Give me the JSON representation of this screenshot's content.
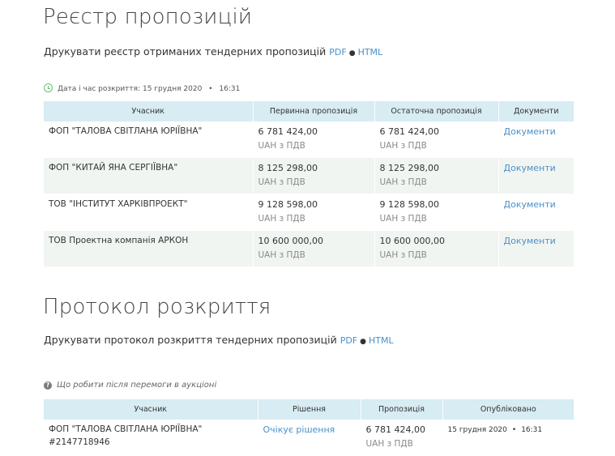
{
  "registry": {
    "title": "Реєстр пропозицій",
    "print_text": "Друкувати реєстр отриманих тендерних пропозицій",
    "pdf_label": "PDF",
    "html_label": "HTML",
    "separator": "●",
    "opening_label": "Дата і час розкриття: 15 грудня 2020",
    "opening_sep": "•",
    "opening_time": "16:31",
    "columns": [
      "Учасник",
      "Первинна пропозиція",
      "Остаточна пропозиція",
      "Документи"
    ],
    "rows": [
      {
        "participant": "ФОП \"ТАЛОВА СВІТЛАНА ЮРІЇВНА\"",
        "initial": "6 781 424,00",
        "initial_currency": "UAH з ПДВ",
        "final": "6 781 424,00",
        "final_currency": "UAH з ПДВ",
        "docs": "Документи"
      },
      {
        "participant": "ФОП \"КИТАЙ ЯНА СЕРГІЇВНА\"",
        "initial": "8 125 298,00",
        "initial_currency": "UAH з ПДВ",
        "final": "8 125 298,00",
        "final_currency": "UAH з ПДВ",
        "docs": "Документи"
      },
      {
        "participant": "ТОВ \"ІНСТИТУТ ХАРКІВПРОЕКТ\"",
        "initial": "9 128 598,00",
        "initial_currency": "UAH з ПДВ",
        "final": "9 128 598,00",
        "final_currency": "UAH з ПДВ",
        "docs": "Документи"
      },
      {
        "participant": "ТОВ Проектна компанія АРКОН",
        "initial": "10 600 000,00",
        "initial_currency": "UAH з ПДВ",
        "final": "10 600 000,00",
        "final_currency": "UAH з ПДВ",
        "docs": "Документи"
      }
    ]
  },
  "protocol": {
    "title": "Протокол розкриття",
    "print_text": "Друкувати протокол розкриття тендерних пропозицій",
    "pdf_label": "PDF",
    "html_label": "HTML",
    "separator": "●",
    "help_link": "Що робити після перемоги в аукціоні",
    "columns": [
      "Учасник",
      "Рішення",
      "Пропозиція",
      "Опубліковано"
    ],
    "rows": [
      {
        "participant": "ФОП \"ТАЛОВА СВІТЛАНА ЮРІЇВНА\"",
        "participant_id": "#2147718946",
        "decision": "Очікує рішення",
        "amount": "6 781 424,00",
        "currency": "UAH з ПДВ",
        "published_date": "15 грудня 2020",
        "published_sep": "•",
        "published_time": "16:31"
      }
    ]
  },
  "colors": {
    "header_bg": "#d7ecf3",
    "stripe_bg": "#f1f5f1",
    "link": "#4a90c8",
    "clock_icon": "#6cc070"
  },
  "icons": {
    "clock": "clock-icon",
    "help": "question-circle-icon"
  }
}
